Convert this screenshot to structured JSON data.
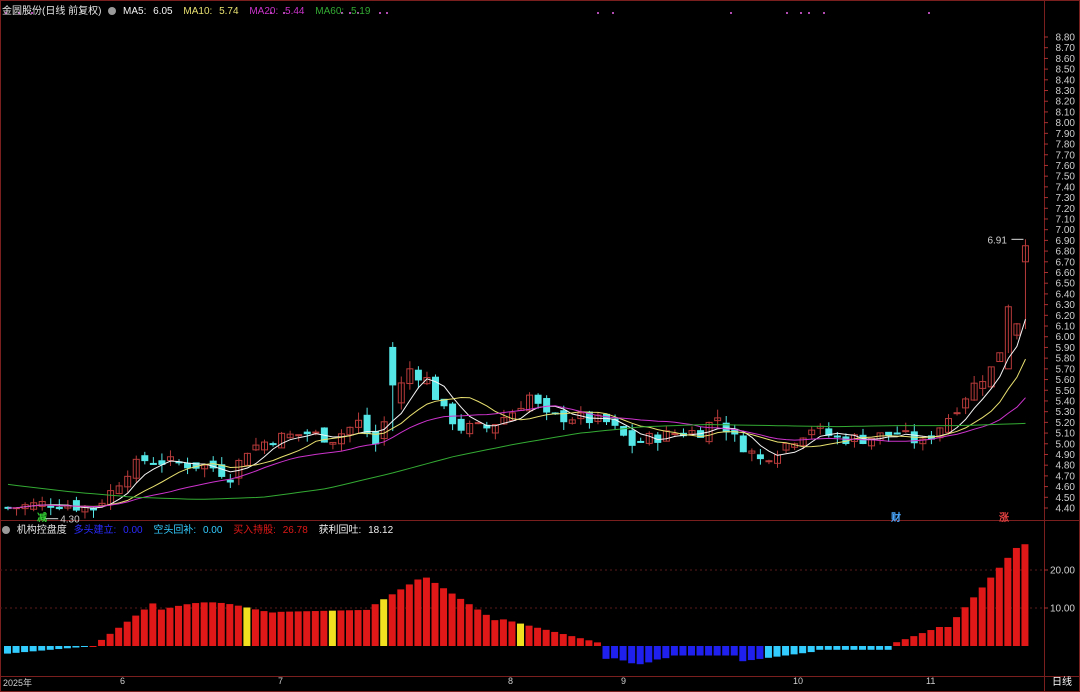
{
  "header": {
    "title": "金圆股份(日线 前复权)",
    "ma5_label": "MA5:",
    "ma5_value": "6.05",
    "ma10_label": "MA10:",
    "ma10_value": "5.74",
    "ma20_label": "MA20:",
    "ma20_value": "5.44",
    "ma60_label": "MA60:",
    "ma60_value": "5.19"
  },
  "sub_header": {
    "title": "机构控盘度",
    "i1_label": "空头回补:",
    "i1_value": "0.00",
    "i2_label": "买入持股:",
    "i2_value": "26.78",
    "i3_label": "获利回吐:",
    "i3_value": "18.12",
    "i0_label": "多头建立:",
    "i0_value": "0.00"
  },
  "period_label": "日线",
  "date_labels": [
    "2025年",
    "6",
    "7",
    "8",
    "9",
    "10",
    "11"
  ],
  "markers": {
    "high_label": "6.91",
    "low_label": "4.30",
    "sig1": "减",
    "sig2": "财",
    "sig3": "涨"
  },
  "colors": {
    "bg": "#000000",
    "up": "#b73a3a",
    "down": "#55e7e7",
    "ma5": "#f5f5f5",
    "ma10": "#e8e070",
    "ma20": "#cc33cc",
    "ma60": "#33aa33",
    "grid": "#7a1e1e",
    "bar_red": "#e01818",
    "bar_blue": "#2020ee",
    "bar_cyan": "#33ccff"
  },
  "chart_data": {
    "type": "candlestick",
    "y_axis_ticks": [
      "8.80",
      "8.70",
      "8.60",
      "8.50",
      "8.40",
      "8.30",
      "8.20",
      "8.10",
      "8.00",
      "7.90",
      "7.80",
      "7.70",
      "7.60",
      "7.50",
      "7.40",
      "7.30",
      "7.20",
      "7.10",
      "7.00",
      "6.90",
      "6.80",
      "6.70",
      "6.60",
      "6.50",
      "6.40",
      "6.30",
      "6.20",
      "6.10",
      "6.00",
      "5.90",
      "5.80",
      "5.70",
      "5.60",
      "5.50",
      "5.40",
      "5.30",
      "5.20",
      "5.10",
      "5.00",
      "4.90",
      "4.80",
      "4.70",
      "4.60",
      "4.50",
      "4.40"
    ],
    "y_range": [
      4.3,
      6.91
    ],
    "sub_y_ticks": [
      "20.00",
      "10.00"
    ],
    "sub_range": [
      -6,
      30
    ]
  }
}
